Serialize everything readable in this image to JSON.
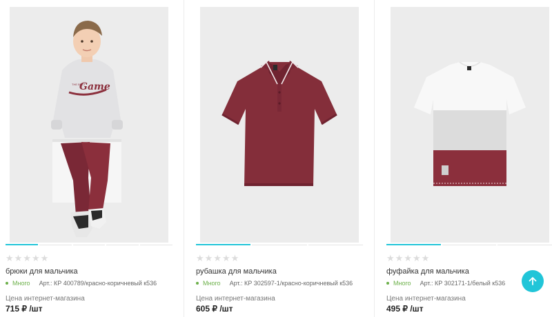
{
  "colors": {
    "accent": "#21c5d8",
    "stock": "#6cb04a",
    "star_empty": "#dcdcdc",
    "maroon": "#8b2f3c",
    "photo_bg": "#ececec"
  },
  "products": [
    {
      "name": "брюки для мальчика",
      "stock": "Много",
      "article": "Арт.: КР 400789/красно-коричневый к536",
      "price_label": "Цена интернет-магазина",
      "price": "715 ₽ /шт",
      "rating_stars": 0,
      "image_icon": "boy-in-sweatshirt-and-pants-photo"
    },
    {
      "name": "рубашка для мальчика",
      "stock": "Много",
      "article": "Арт.: КР 302597-1/красно-коричневый к536",
      "price_label": "Цена интернет-магазина",
      "price": "605 ₽ /шт",
      "rating_stars": 0,
      "image_icon": "polo-shirt-photo"
    },
    {
      "name": "фуфайка для мальчика",
      "stock": "Много",
      "article": "Арт.: КР 302171-1/белый к536",
      "price_label": "Цена интернет-магазина",
      "price": "495 ₽ /шт",
      "rating_stars": 0,
      "image_icon": "tshirt-photo"
    }
  ],
  "scroll_top": {
    "icon": "arrow-up-icon"
  }
}
